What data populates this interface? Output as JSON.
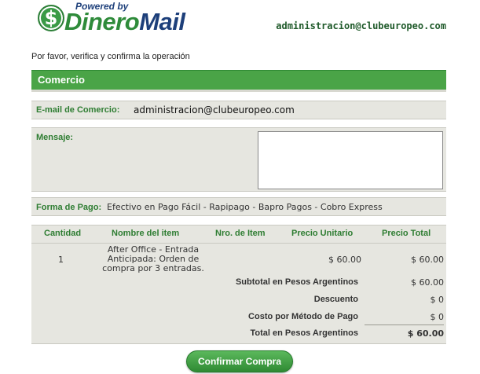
{
  "header": {
    "powered_by": "Powered by",
    "brand_part1": "Dinero",
    "brand_part2": "Mail",
    "logo_symbol": "$",
    "merchant_email": "administracion@clubeuropeo.com"
  },
  "instruction": "Por favor, verifica y confirma la operación",
  "section_title": "Comercio",
  "merchant": {
    "email_label": "E-mail de Comercio:",
    "email_value": "administracion@clubeuropeo.com",
    "message_label": "Mensaje:",
    "message_value": "",
    "payment_label": "Forma de Pago:",
    "payment_value": "Efectivo en Pago Fácil - Rapipago - Bapro Pagos - Cobro Express"
  },
  "table": {
    "columns": [
      "Cantidad",
      "Nombre del item",
      "Nro. de Item",
      "Precio Unitario",
      "Precio Total"
    ],
    "items": [
      {
        "quantity": "1",
        "name_lines": [
          "After Office - Entrada",
          "Anticipada: Orden de",
          "compra por 3 entradas."
        ],
        "item_number": "",
        "unit_price": "$ 60.00",
        "total_price": "$ 60.00"
      }
    ],
    "totals": [
      {
        "label": "Subtotal en Pesos Argentinos",
        "value": "$ 60.00"
      },
      {
        "label": "Descuento",
        "value": "$ 0"
      },
      {
        "label": "Costo por Método de Pago",
        "value": "$ 0"
      },
      {
        "label": "Total en Pesos Argentinos",
        "value": "$ 60.00"
      }
    ]
  },
  "confirm_button": "Confirmar Compra",
  "colors": {
    "accent_green": "#4aa447",
    "label_green": "#2e7d32",
    "brand_blue": "#1d3f7a",
    "panel_gray": "#e6e6e0"
  },
  "icons": {
    "logo": "dollar-circle-icon"
  }
}
